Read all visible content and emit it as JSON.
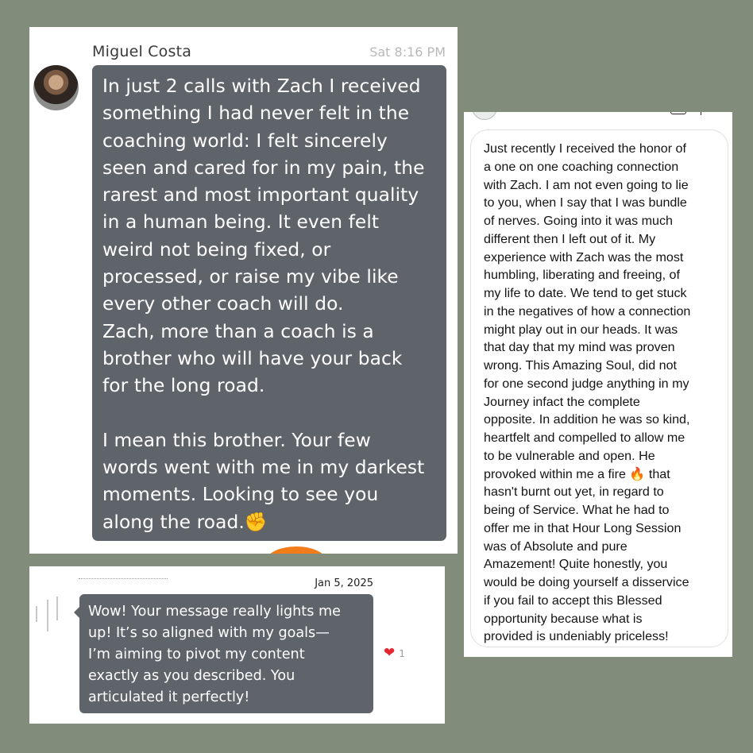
{
  "card1": {
    "sender": "Miguel Costa",
    "time": "Sat 8:16 PM",
    "message": "In just 2 calls with Zach I received\nsomething I had never felt in the\ncoaching world: I felt sincerely\nseen and cared for in my pain, the\nrarest and most important quality\nin a human being. It even felt\nweird not being fixed, or\nprocessed, or raise my vibe like\nevery other coach will do.\nZach, more than a coach is a\nbrother who will have your back\nfor the long road.\n\nI mean this brother. Your few\nwords went with me in my darkest\nmoments. Looking to see you\nalong the road.✊"
  },
  "card2": {
    "date": "Jan 5, 2025",
    "message": "Wow! Your message really lights me\nup! It’s so aligned with my goals—\nI’m aiming to pivot my content\nexactly as you described. You\narticulated it perfectly!",
    "reaction_icon": "heart-icon",
    "reaction_glyph": "❤",
    "reaction_count": "1"
  },
  "card3": {
    "message": "Just recently I received the honor of\na one on one coaching connection\nwith Zach. I am not even going to lie\nto you, when I say that I was bundle\nof nerves. Going into it was much\ndifferent then I left out of it. My\nexperience with Zach was the most\nhumbling, liberating and freeing, of\nmy life to date. We tend to get stuck\nin the negatives of how a connection\nmight play out in our heads. It was\nthat day that my mind was proven\nwrong. This Amazing Soul, did not\nfor one second judge anything in my\nJourney infact the complete\nopposite. In addition he was so kind,\nheartfelt and compelled to allow me\nto be vulnerable and open. He\nprovoked within me a fire 🔥 that\nhasn't burnt out yet, in regard to\nbeing of Service. What he had to\noffer me in that Hour Long Session\nwas of Absolute and pure\nAmazement!  Quite honestly, you\nwould be doing yourself a disservice\nif you fail to accept this Blessed\nopportunity because what is\nprovided is undeniably priceless!"
  },
  "colors": {
    "background": "#818c7a",
    "bubble": "#5f646b",
    "heart": "#e5262f",
    "orange": "#f07d1a"
  }
}
